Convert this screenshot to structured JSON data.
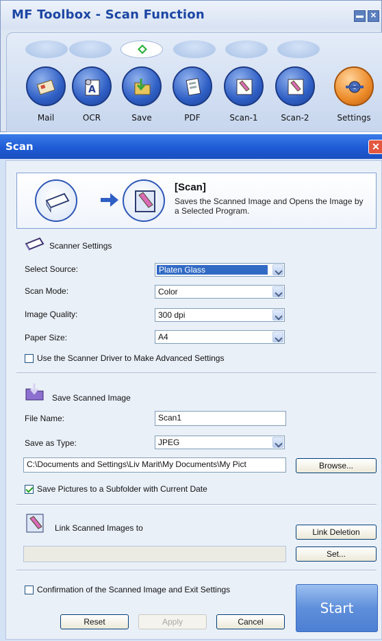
{
  "toolbox": {
    "title": "MF Toolbox - Scan Function",
    "buttons": [
      {
        "label": "Mail",
        "icon": "mail-icon"
      },
      {
        "label": "OCR",
        "icon": "ocr-icon"
      },
      {
        "label": "Save",
        "icon": "save-icon"
      },
      {
        "label": "PDF",
        "icon": "pdf-icon"
      },
      {
        "label": "Scan-1",
        "icon": "scan-1-icon"
      },
      {
        "label": "Scan-2",
        "icon": "scan-2-icon"
      },
      {
        "label": "Settings",
        "icon": "settings-icon"
      }
    ],
    "selected": "Save"
  },
  "dialog": {
    "title": "Scan",
    "banner_title": "[Scan]",
    "banner_desc": "Saves the Scanned Image and Opens the Image by a Selected Program."
  },
  "scanner_settings": {
    "heading": "Scanner Settings",
    "select_source_label": "Select Source:",
    "select_source_value": "Platen Glass",
    "scan_mode_label": "Scan Mode:",
    "scan_mode_value": "Color",
    "image_quality_label": "Image Quality:",
    "image_quality_value": "300 dpi",
    "paper_size_label": "Paper Size:",
    "paper_size_value": "A4",
    "advanced_label": "Use the Scanner Driver to Make Advanced Settings",
    "advanced_checked": false
  },
  "save_image": {
    "heading": "Save Scanned Image",
    "file_name_label": "File Name:",
    "file_name_value": "Scan1",
    "save_type_label": "Save as Type:",
    "save_type_value": "JPEG",
    "path_value": "C:\\Documents and Settings\\Liv Marit\\My Documents\\My Pict",
    "browse_label": "Browse...",
    "subfolder_label": "Save Pictures to a Subfolder with Current Date",
    "subfolder_checked": true
  },
  "link": {
    "heading": "Link Scanned Images to",
    "link_deletion_label": "Link Deletion",
    "set_label": "Set..."
  },
  "footer": {
    "confirm_label": "Confirmation of the Scanned Image and Exit Settings",
    "confirm_checked": false,
    "reset_label": "Reset",
    "apply_label": "Apply",
    "cancel_label": "Cancel",
    "start_label": "Start"
  },
  "colors": {
    "title_bar": "#1e5bd6",
    "toolbox_title": "#1c46a3",
    "dialog_bg": "#eaf0f8",
    "selection": "#316ac5",
    "start_button": "#5f8fdb"
  }
}
